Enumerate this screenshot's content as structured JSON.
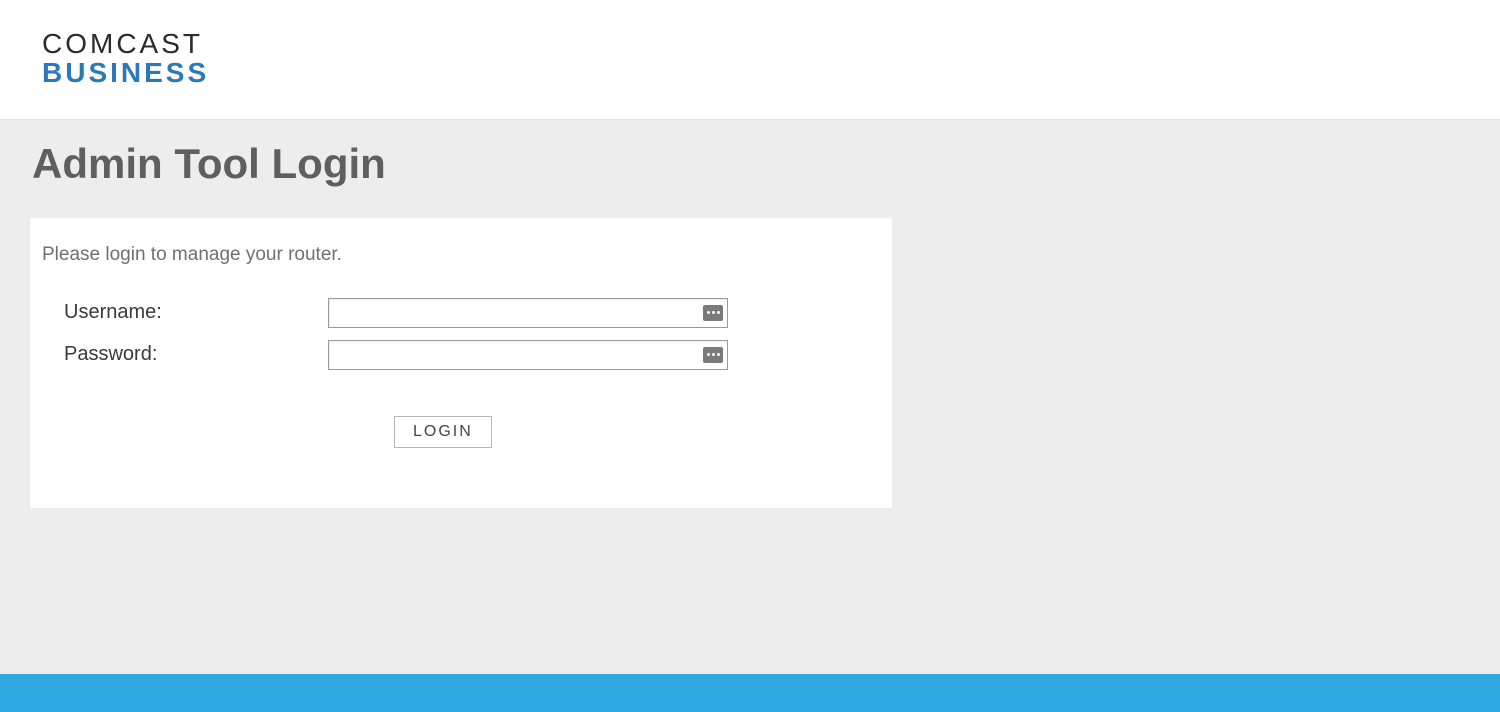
{
  "brand": {
    "line1": "COMCAST",
    "line2": "BUSINESS"
  },
  "page": {
    "title": "Admin Tool Login",
    "instruction": "Please login to manage your router."
  },
  "form": {
    "username_label": "Username:",
    "username_value": "",
    "password_label": "Password:",
    "password_value": "",
    "login_button": "LOGIN"
  },
  "colors": {
    "accent": "#2fa7e0",
    "brand_blue": "#2a7ab8"
  }
}
